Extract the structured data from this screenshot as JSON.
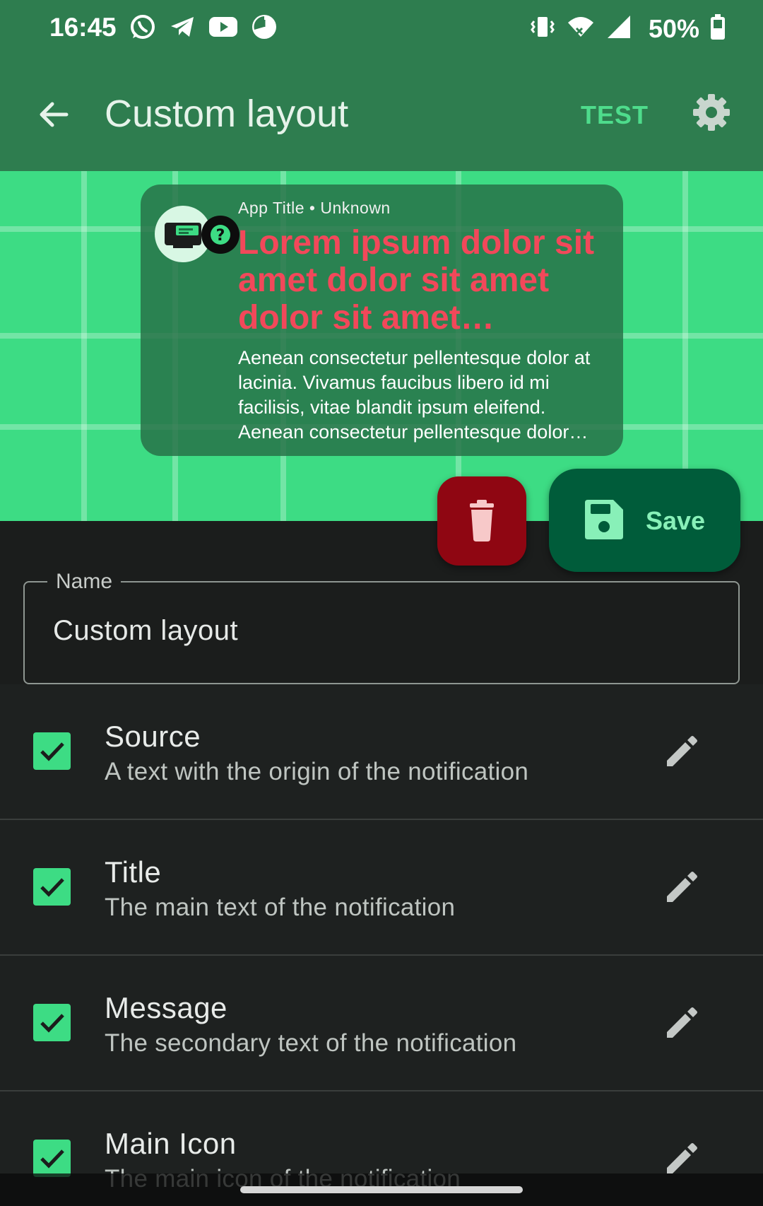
{
  "status_bar": {
    "time": "16:45",
    "battery": "50%",
    "app_icons": [
      "whatsapp-icon",
      "telegram-icon",
      "youtube-icon",
      "pie-chart-icon"
    ],
    "system_icons": [
      "vibrate-icon",
      "wifi-icon",
      "signal-icon",
      "battery-icon"
    ]
  },
  "app_bar": {
    "title": "Custom layout",
    "test_label": "TEST",
    "colors": {
      "bar": "#2e7d4f",
      "accent": "#4edc8c"
    }
  },
  "preview": {
    "background": "#3ddc84",
    "notification": {
      "source": "App Title • Unknown",
      "title": "Lorem ipsum dolor sit amet dolor sit amet dolor sit amet…",
      "message": "Aenean consectetur pellentesque dolor at lacinia. Vivamus faucibus libero id mi facilisis, vitae blandit ipsum eleifend. Aenean consectetur pellentesque dolor…",
      "title_color": "#f2485a"
    }
  },
  "actions": {
    "save_label": "Save",
    "delete_icon": "trash-icon",
    "save_icon": "floppy-disk-icon"
  },
  "name_field": {
    "label": "Name",
    "value": "Custom layout"
  },
  "elements": [
    {
      "title": "Source",
      "subtitle": "A text with the origin of the notification",
      "checked": true
    },
    {
      "title": "Title",
      "subtitle": "The main text of the notification",
      "checked": true
    },
    {
      "title": "Message",
      "subtitle": "The secondary text of the notification",
      "checked": true
    },
    {
      "title": "Main Icon",
      "subtitle": "The main icon of the notification",
      "checked": true
    }
  ]
}
